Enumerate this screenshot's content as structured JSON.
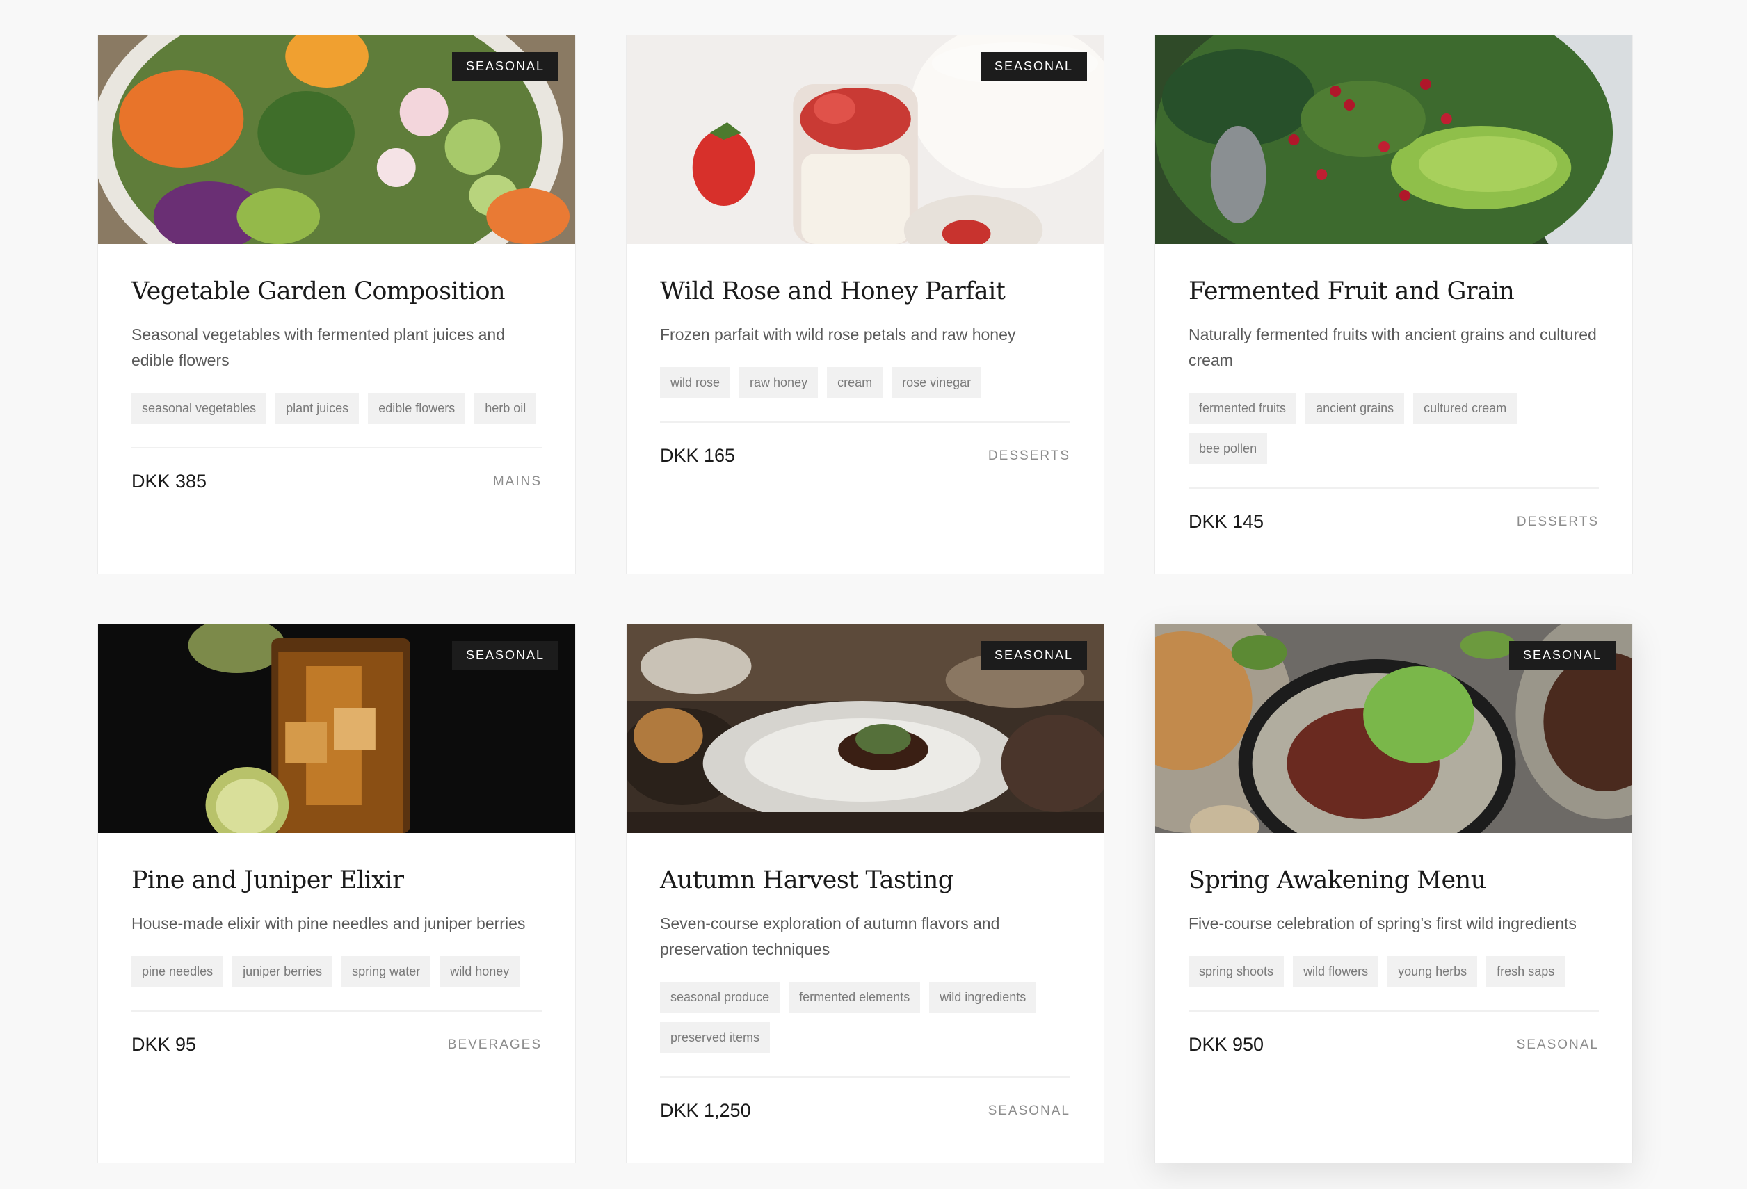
{
  "cards": [
    {
      "badge": "SEASONAL",
      "title": "Vegetable Garden Composition",
      "description": "Seasonal vegetables with fermented plant juices and edible flowers",
      "tags": [
        "seasonal vegetables",
        "plant juices",
        "edible flowers",
        "herb oil"
      ],
      "price": "DKK 385",
      "category": "MAINS",
      "image_alt": "salad bowl with carrots, radishes, cucumber and greens"
    },
    {
      "badge": "SEASONAL",
      "title": "Wild Rose and Honey Parfait",
      "description": "Frozen parfait with wild rose petals and raw honey",
      "tags": [
        "wild rose",
        "raw honey",
        "cream",
        "rose vinegar"
      ],
      "price": "DKK 165",
      "category": "DESSERTS",
      "image_alt": "jars of yogurt parfait with strawberries"
    },
    {
      "badge": "",
      "title": "Fermented Fruit and Grain",
      "description": "Naturally fermented fruits with ancient grains and cultured cream",
      "tags": [
        "fermented fruits",
        "ancient grains",
        "cultured cream",
        "bee pollen"
      ],
      "price": "DKK 145",
      "category": "DESSERTS",
      "image_alt": "green salad with avocado and pomegranate seeds"
    },
    {
      "badge": "SEASONAL",
      "title": "Pine and Juniper Elixir",
      "description": "House-made elixir with pine needles and juniper berries",
      "tags": [
        "pine needles",
        "juniper berries",
        "spring water",
        "wild honey"
      ],
      "price": "DKK 95",
      "category": "BEVERAGES",
      "image_alt": "iced amber drink with lime on dark background"
    },
    {
      "badge": "SEASONAL",
      "title": "Autumn Harvest Tasting",
      "description": "Seven-course exploration of autumn flavors and preservation techniques",
      "tags": [
        "seasonal produce",
        "fermented elements",
        "wild ingredients",
        "preserved items"
      ],
      "price": "DKK 1,250",
      "category": "SEASONAL",
      "image_alt": "plated dish on restaurant table"
    },
    {
      "badge": "SEASONAL",
      "title": "Spring Awakening Menu",
      "description": "Five-course celebration of spring's first wild ingredients",
      "tags": [
        "spring shoots",
        "wild flowers",
        "young herbs",
        "fresh saps"
      ],
      "price": "DKK 950",
      "category": "SEASONAL",
      "image_alt": "bowls of steak salad with cashews"
    }
  ]
}
